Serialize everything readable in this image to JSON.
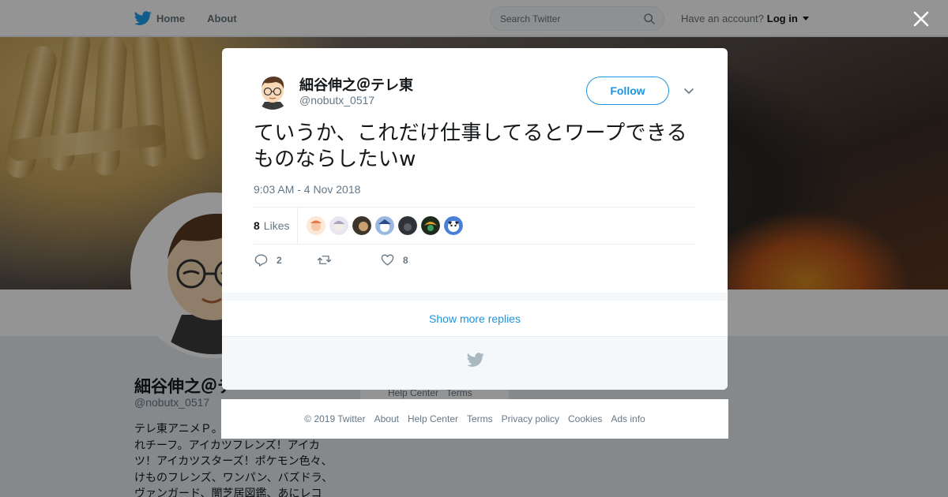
{
  "topbar": {
    "home_label": "Home",
    "about_label": "About",
    "search_placeholder": "Search Twitter",
    "account_prompt": "Have an account?",
    "login_label": "Log in"
  },
  "background_profile": {
    "name": "細谷伸之＠テ",
    "handle": "@nobutx_0517",
    "bio": "テレ東アニメＰ。\nれチーフ。アイカツフレンズ！アイカツ！アイカツスターズ！ポケモン色々、けものフレンズ、ワンパン、バズドラ、ヴァンガード、闇芝居図鑑、あにレコ",
    "help_links": [
      "Help Center",
      "Terms"
    ]
  },
  "tweet": {
    "author_name": "細谷伸之＠テレ東",
    "author_handle": "@nobutx_0517",
    "follow_label": "Follow",
    "text": "ていうか、これだけ仕事してるとワープできるものならしたいw",
    "timestamp": "9:03 AM - 4 Nov 2018",
    "likes_count": "8",
    "likes_label": "Likes",
    "reply_count": "2",
    "retweet_count": "",
    "like_count": "8",
    "likers": [
      {
        "icon": "liker-avatar-1",
        "color": "#f6c8a8"
      },
      {
        "icon": "liker-avatar-2",
        "color": "#c9c6d6"
      },
      {
        "icon": "liker-avatar-3",
        "color": "#3d342c"
      },
      {
        "icon": "liker-avatar-4",
        "color": "#9ab8e0"
      },
      {
        "icon": "liker-avatar-5",
        "color": "#2f3236"
      },
      {
        "icon": "liker-avatar-6",
        "color": "#e0a020"
      },
      {
        "icon": "liker-avatar-7",
        "color": "#4a7fd6"
      }
    ]
  },
  "modal": {
    "show_more_replies": "Show more replies"
  },
  "footer": {
    "copyright": "© 2019 Twitter",
    "links": [
      "About",
      "Help Center",
      "Terms",
      "Privacy policy",
      "Cookies",
      "Ads info"
    ]
  },
  "colors": {
    "twitter_blue": "#1da1f2",
    "link_blue": "#1b95e0",
    "muted_text": "#657786"
  }
}
